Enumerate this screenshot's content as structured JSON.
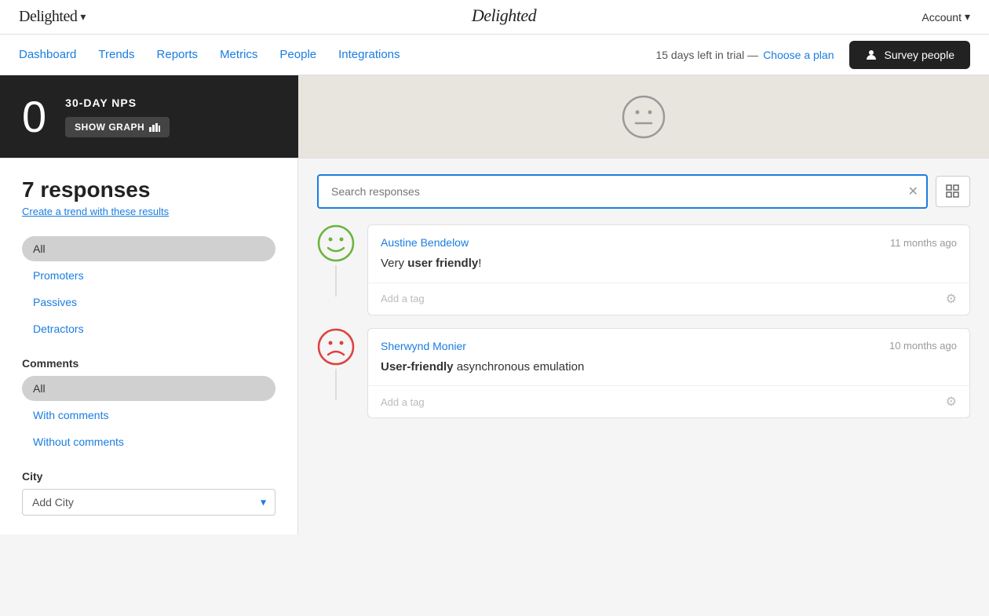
{
  "topbar": {
    "brand": "Delighted",
    "brand_chevron": "▾",
    "account_label": "Account",
    "account_chevron": "▾"
  },
  "navbar": {
    "links": [
      {
        "id": "dashboard",
        "label": "Dashboard"
      },
      {
        "id": "trends",
        "label": "Trends"
      },
      {
        "id": "reports",
        "label": "Reports"
      },
      {
        "id": "metrics",
        "label": "Metrics"
      },
      {
        "id": "people",
        "label": "People"
      },
      {
        "id": "integrations",
        "label": "Integrations"
      }
    ],
    "trial_text": "15 days left in trial —",
    "choose_plan_label": "Choose a plan",
    "survey_btn_label": "Survey people"
  },
  "nps": {
    "score": "0",
    "label": "30-DAY NPS",
    "show_graph_label": "SHOW GRAPH",
    "chart_icon": "📊"
  },
  "sidebar": {
    "responses_count": "7 responses",
    "create_trend_label": "Create a trend with these results",
    "filters": [
      {
        "id": "all",
        "label": "All",
        "active": true
      },
      {
        "id": "promoters",
        "label": "Promoters",
        "active": false
      },
      {
        "id": "passives",
        "label": "Passives",
        "active": false
      },
      {
        "id": "detractors",
        "label": "Detractors",
        "active": false
      }
    ],
    "comments_section": "Comments",
    "comment_filters": [
      {
        "id": "all-comments",
        "label": "All",
        "active": true
      },
      {
        "id": "with-comments",
        "label": "With comments",
        "active": false
      },
      {
        "id": "without-comments",
        "label": "Without comments",
        "active": false
      }
    ],
    "city_label": "City",
    "city_placeholder": "Add City"
  },
  "search": {
    "placeholder": "Search responses"
  },
  "responses": [
    {
      "id": "r1",
      "name": "Austine Bendelow",
      "time": "11 months ago",
      "text_pre": "Very ",
      "text_bold": "user friendly",
      "text_post": "!",
      "tag_placeholder": "Add a tag",
      "face_type": "promoter"
    },
    {
      "id": "r2",
      "name": "Sherwynd Monier",
      "time": "10 months ago",
      "text_pre": "",
      "text_bold": "User-friendly",
      "text_post": " asynchronous emulation",
      "tag_placeholder": "Add a tag",
      "face_type": "detractor"
    }
  ],
  "colors": {
    "accent": "#1a7de0",
    "promoter": "#6db33f",
    "detractor": "#e04040",
    "passive": "#f0a030"
  }
}
